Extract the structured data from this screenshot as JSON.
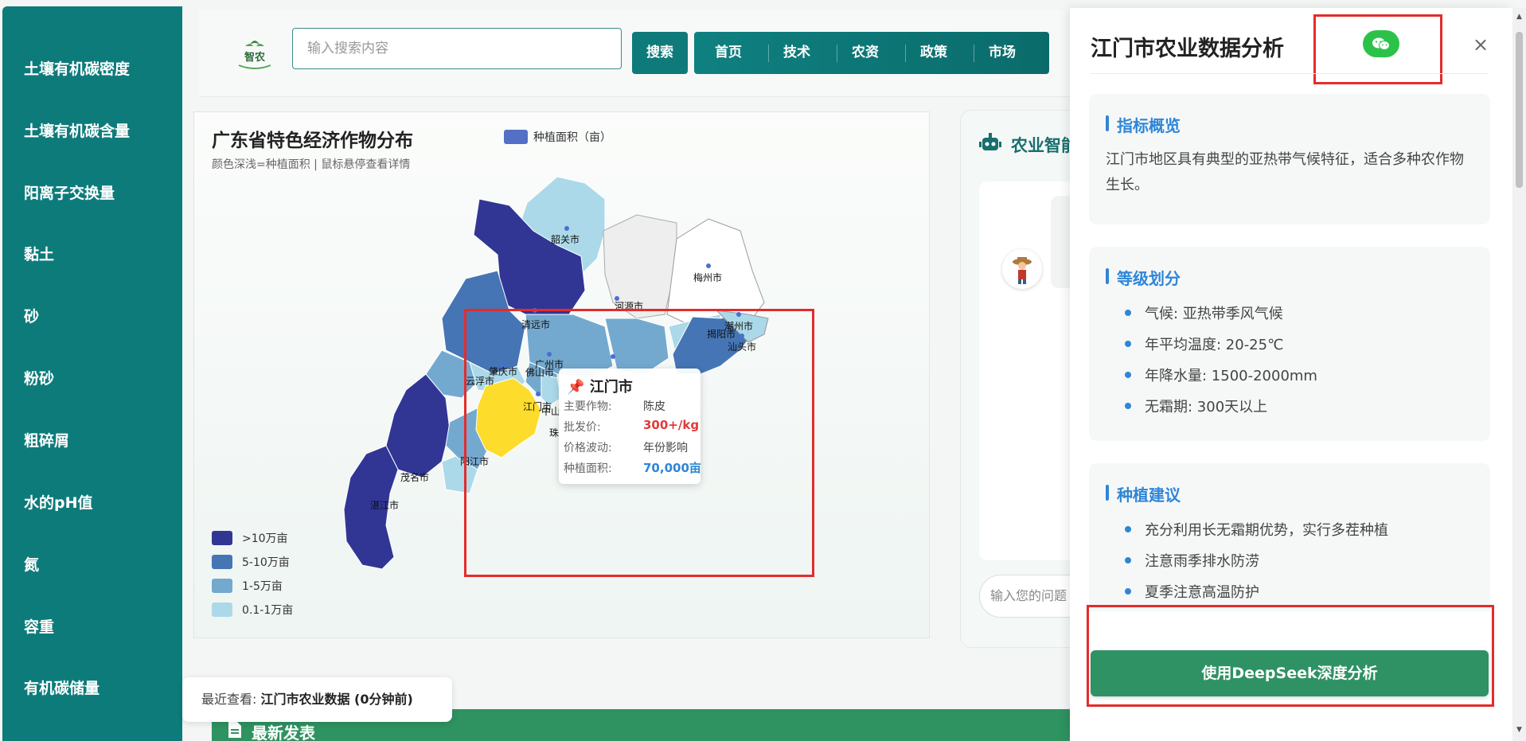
{
  "sidebar": {
    "items": [
      {
        "label": "土壤有机碳密度"
      },
      {
        "label": "土壤有机碳含量"
      },
      {
        "label": "阳离子交换量"
      },
      {
        "label": "黏土"
      },
      {
        "label": "砂"
      },
      {
        "label": "粉砂"
      },
      {
        "label": "粗碎屑"
      },
      {
        "label": "水的pH值"
      },
      {
        "label": "氮"
      },
      {
        "label": "容重"
      },
      {
        "label": "有机碳储量"
      }
    ]
  },
  "header": {
    "logo_text": "智农",
    "search_placeholder": "输入搜索内容",
    "search_button": "搜索",
    "nav": [
      {
        "label": "首页"
      },
      {
        "label": "技术"
      },
      {
        "label": "农资"
      },
      {
        "label": "政策"
      },
      {
        "label": "市场"
      }
    ]
  },
  "map": {
    "title": "广东省特色经济作物分布",
    "subtitle": "颜色深浅=种植面积 | 鼠标悬停查看详情",
    "series_legend": "种植面积（亩）",
    "series_color": "#5470c6",
    "visual_map": [
      {
        "label": ">10万亩",
        "color": "#313695"
      },
      {
        "label": "5-10万亩",
        "color": "#4575b4"
      },
      {
        "label": "1-5万亩",
        "color": "#74a9cf"
      },
      {
        "label": "0.1-1万亩",
        "color": "#abd9e9"
      }
    ],
    "highlight_color": "#fddc2c",
    "city_labels": [
      {
        "name": "韶关市"
      },
      {
        "name": "梅州市"
      },
      {
        "name": "河源市"
      },
      {
        "name": "清远市"
      },
      {
        "name": "潮州市"
      },
      {
        "name": "揭阳市"
      },
      {
        "name": "汕头市"
      },
      {
        "name": "肇庆市"
      },
      {
        "name": "广州市"
      },
      {
        "name": "云浮市"
      },
      {
        "name": "佛山市"
      },
      {
        "name": "江门市"
      },
      {
        "name": "中山"
      },
      {
        "name": "珠"
      },
      {
        "name": "阳江市"
      },
      {
        "name": "茂名市"
      },
      {
        "name": "湛江市"
      }
    ],
    "tooltip": {
      "pin_icon": "📌",
      "title": "江门市",
      "rows": [
        {
          "key": "主要作物:",
          "value": "陈皮"
        },
        {
          "key": "批发价:",
          "value": "300+/kg"
        },
        {
          "key": "价格波动:",
          "value": "年份影响"
        },
        {
          "key": "种植面积:",
          "value": "70,000亩"
        }
      ]
    }
  },
  "ai": {
    "title": "农业智能",
    "input_placeholder": "输入您的问题"
  },
  "recent": {
    "prefix": "最近查看: ",
    "value": "江门市农业数据 (0分钟前)"
  },
  "publish": {
    "label": "最新发表"
  },
  "panel": {
    "title": "江门市农业数据分析",
    "close": "×",
    "sections": [
      {
        "title": "指标概览",
        "text": "江门市地区具有典型的亚热带气候特征，适合多种农作物生长。"
      },
      {
        "title": "等级划分",
        "items": [
          "气候: 亚热带季风气候",
          "年平均温度: 20-25℃",
          "年降水量: 1500-2000mm",
          "无霜期: 300天以上"
        ]
      },
      {
        "title": "种植建议",
        "items": [
          "充分利用长无霜期优势，实行多茬种植",
          "注意雨季排水防涝",
          "夏季注意高温防护"
        ]
      }
    ],
    "deepseek_button": "使用DeepSeek深度分析"
  }
}
